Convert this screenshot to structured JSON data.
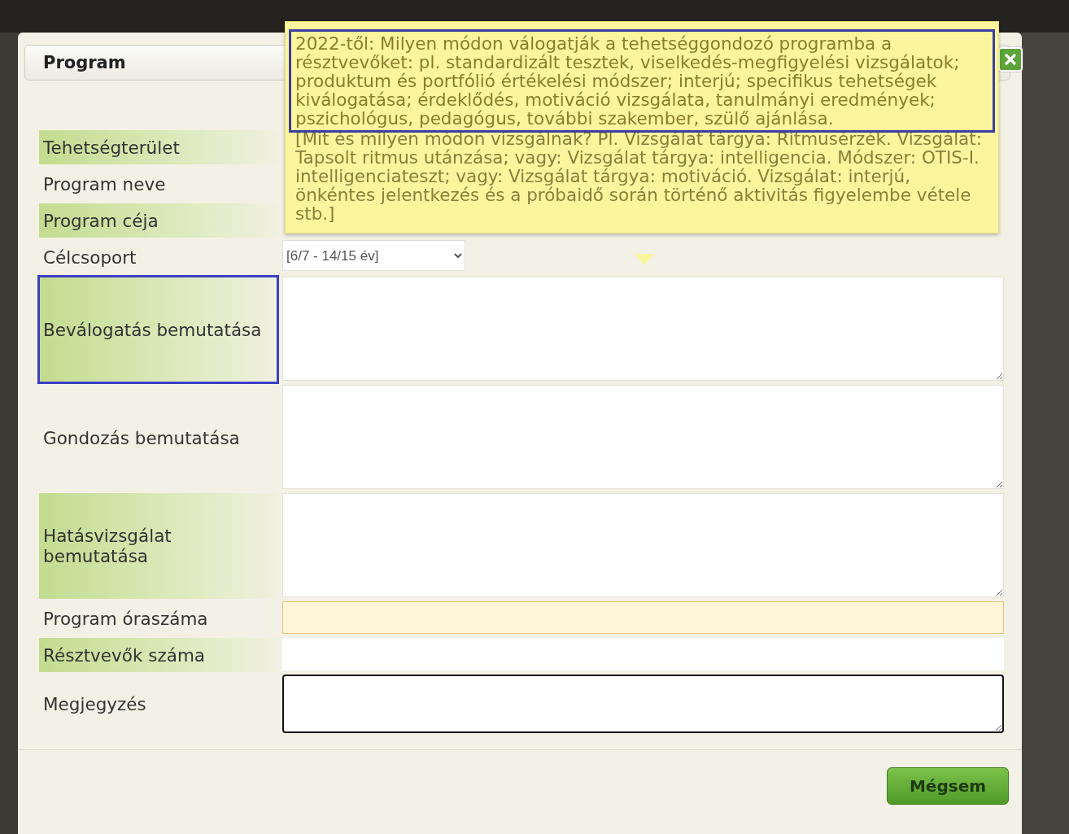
{
  "dialog": {
    "title": "Program",
    "close_icon": true
  },
  "tooltip": {
    "paragraphs": [
      {
        "text": "2022-től: Milyen módon válogatják a tehetséggondozó programba a résztvevőket: pl. standardizált tesztek, viselkedés-megfigyelési vizsgálatok; produktum és portfólió értékelési módszer; interjú; specifikus tehetségek kiválogatása; érdeklődés, motiváció vizsgálata, tanulmányi eredmények; pszichológus, pedagógus, további szakember, szülő ajánlása.",
        "outlined": true
      },
      {
        "text": "[Mit és milyen módon vizsgálnak? Pl. Vizsgálat tárgya: Ritmusérzék. Vizsgálat: Tapsolt ritmus utánzása; vagy: Vizsgálat tárgya: intelligencia. Módszer: OTIS-I. intelligenciateszt; vagy: Vizsgálat tárgya: motiváció. Vizsgálat: interjú, önkéntes jelentkezés és a próbaidő során történő aktivitás figyelembe vétele stb.]",
        "outlined": false
      }
    ]
  },
  "rows": [
    {
      "label": "Tehetségterület",
      "highlighted": true,
      "focused": false
    },
    {
      "label": "Program neve",
      "highlighted": false,
      "focused": false
    },
    {
      "label": "Program céja",
      "highlighted": true,
      "focused": false
    },
    {
      "label": "Célcsoport",
      "highlighted": false,
      "focused": false,
      "field": {
        "kind": "select",
        "value": "[6/7 - 14/15 év]",
        "marked": false,
        "focused": false
      }
    },
    {
      "label": "Beválogatás bemutatása",
      "highlighted": true,
      "focused": true,
      "field": {
        "kind": "textarea",
        "marked": false,
        "focused": false
      }
    },
    {
      "label": "Gondozás bemutatása",
      "highlighted": false,
      "focused": false,
      "field": {
        "kind": "textarea",
        "marked": false,
        "focused": false
      }
    },
    {
      "label": "Hatásvizsgálat bemutatása",
      "highlighted": true,
      "focused": false,
      "field": {
        "kind": "textarea",
        "marked": false,
        "focused": false
      }
    },
    {
      "label": "Program óraszáma",
      "highlighted": false,
      "focused": false,
      "field": {
        "kind": "input",
        "marked": true,
        "focused": false
      }
    },
    {
      "label": "Résztvevők száma",
      "highlighted": true,
      "focused": false,
      "field": {
        "kind": "input",
        "marked": false,
        "focused": false
      }
    },
    {
      "label": "Megjegyzés",
      "highlighted": false,
      "focused": false,
      "field": {
        "kind": "memo",
        "marked": false,
        "focused": true
      }
    }
  ],
  "buttons": [
    {
      "label": "Mégsem"
    }
  ]
}
